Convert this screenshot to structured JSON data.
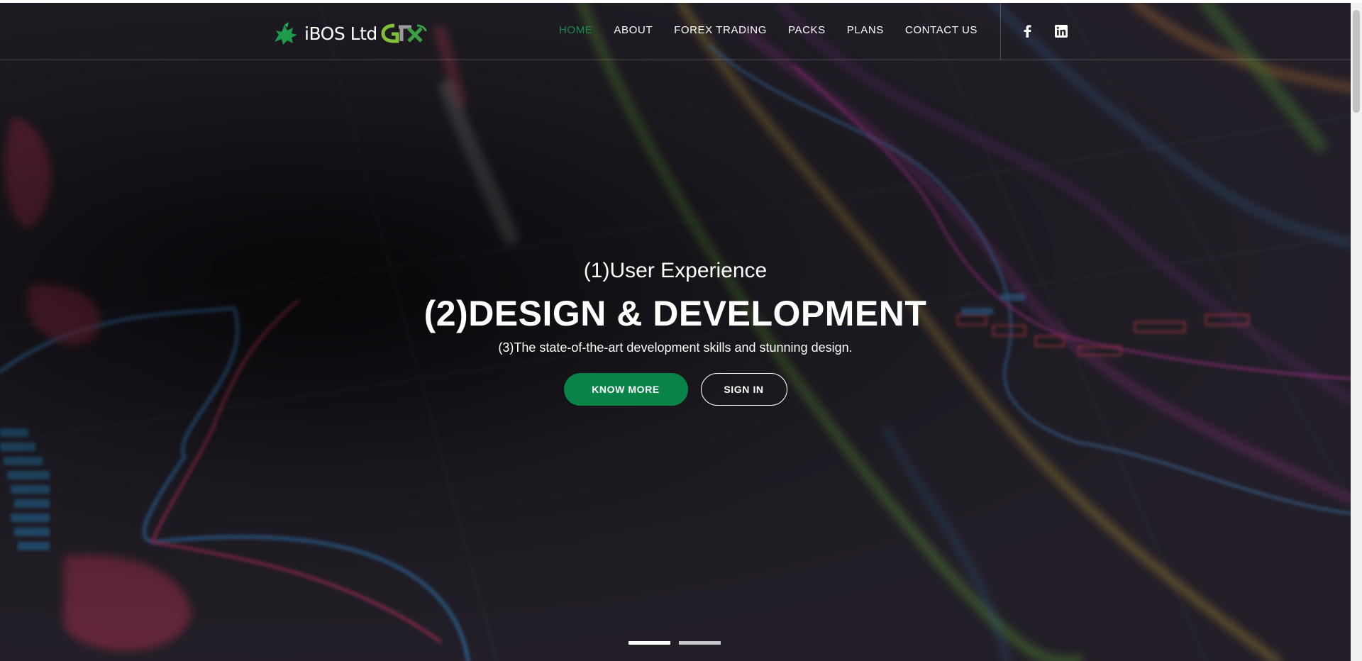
{
  "header": {
    "brand": "iBOS Ltd",
    "nav": [
      {
        "label": "HOME",
        "active": true
      },
      {
        "label": "ABOUT"
      },
      {
        "label": "FOREX TRADING"
      },
      {
        "label": "PACKS"
      },
      {
        "label": "PLANS"
      },
      {
        "label": "CONTACT US"
      }
    ],
    "social": [
      "facebook-icon",
      "linkedin-icon"
    ]
  },
  "hero": {
    "subtitle": "(1)User Experience",
    "title": "(2)DESIGN & DEVELOPMENT",
    "tagline": "(3)The state-of-the-art development skills and stunning design.",
    "primary_button": "KNOW MORE",
    "secondary_button": "SIGN IN",
    "slide_count": 2,
    "active_slide": 1
  },
  "colors": {
    "accent_green": "#088449",
    "active_nav": "#1a8a4c",
    "background": "#26222a"
  }
}
